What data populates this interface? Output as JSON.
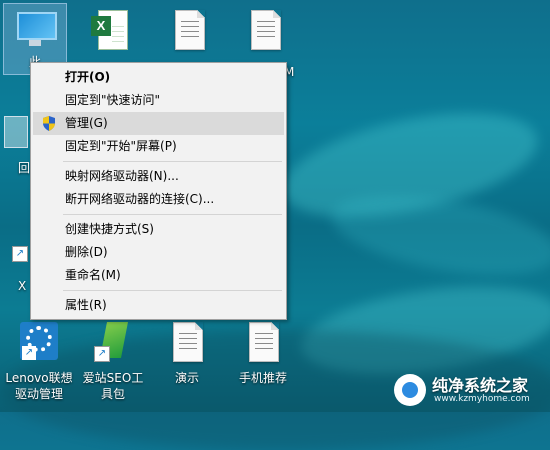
{
  "desktop": {
    "icons": [
      {
        "id": "this-pc",
        "label": "此"
      },
      {
        "id": "excel-file",
        "label": ""
      },
      {
        "id": "doc-file-1",
        "label": ""
      },
      {
        "id": "doc-file-2",
        "label": "M"
      },
      {
        "id": "recycle-bin",
        "label": "回"
      },
      {
        "id": "shortcut-x",
        "label": "X"
      },
      {
        "id": "lenovo-driver",
        "label": "Lenovo联想驱动管理"
      },
      {
        "id": "seo-toolbox",
        "label": "爱站SEO工具包"
      },
      {
        "id": "demo-doc",
        "label": "演示"
      },
      {
        "id": "phone-recommend",
        "label": "手机推荐"
      }
    ]
  },
  "context_menu": {
    "items": [
      {
        "label": "打开(O)",
        "bold": true
      },
      {
        "label": "固定到\"快速访问\""
      },
      {
        "label": "管理(G)",
        "highlighted": true,
        "icon": "uac-shield-icon"
      },
      {
        "label": "固定到\"开始\"屏幕(P)"
      },
      {
        "label": "映射网络驱动器(N)..."
      },
      {
        "label": "断开网络驱动器的连接(C)..."
      },
      {
        "label": "创建快捷方式(S)"
      },
      {
        "label": "删除(D)"
      },
      {
        "label": "重命名(M)"
      },
      {
        "label": "属性(R)"
      }
    ]
  },
  "watermark": {
    "title": "纯净系统之家",
    "url": "www.kzmyhome.com"
  },
  "colors": {
    "menu_bg": "#f2f2f2",
    "menu_highlight": "#dadada",
    "desktop_teal": "#0b7f9a"
  }
}
